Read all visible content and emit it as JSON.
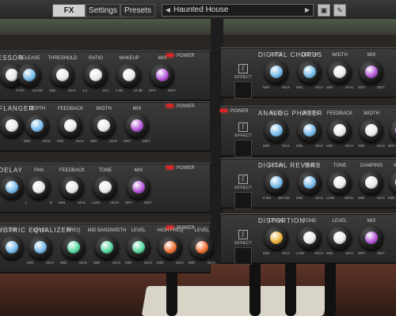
{
  "toolbar": {
    "tabs": [
      {
        "label": "FX",
        "active": true
      },
      {
        "label": "Settings",
        "active": false
      },
      {
        "label": "Presets",
        "active": false
      }
    ],
    "preset_name": "Haunted House",
    "prev_arrow": "◀",
    "next_arrow": "▶",
    "icons": [
      "save-icon",
      "edit-icon"
    ]
  },
  "colors": {
    "blue": "#6fb6e8",
    "white": "#e8e8e8",
    "purple": "#b24fd6",
    "green": "#4fd69a",
    "orange": "#ee6a2c",
    "yellow": "#e8b030",
    "led": "#e02222"
  },
  "power_label": "POWER",
  "effect_label": "EFFECT",
  "modules": [
    {
      "id": "compressor",
      "title": "RESSOR",
      "knobs": [
        {
          "label": "",
          "min": "",
          "max": "",
          "color": "white"
        },
        {
          "label": "RELEASE",
          "min": "FAST",
          "max": "SLOW",
          "color": "blue"
        },
        {
          "label": "THRESHOLD",
          "min": "MIN",
          "max": "MAX",
          "color": "white"
        },
        {
          "label": "RATIO",
          "min": "1:1",
          "max": "10:1",
          "color": "white"
        },
        {
          "label": "MAKEUP",
          "min": "0 dB",
          "max": "24 dB",
          "color": "white"
        },
        {
          "label": "MIX",
          "min": "DRY",
          "max": "WET",
          "color": "purple"
        }
      ]
    },
    {
      "id": "flanger",
      "title": "L FLANGER",
      "knobs": [
        {
          "label": "",
          "min": "",
          "max": "",
          "color": "white"
        },
        {
          "label": "DEPTH",
          "min": "MIN",
          "max": "MAX",
          "color": "blue"
        },
        {
          "label": "FEEDBACK",
          "min": "MIN",
          "max": "MAX",
          "color": "white"
        },
        {
          "label": "WIDTH",
          "min": "MIN",
          "max": "MAX",
          "color": "white"
        },
        {
          "label": "MIX",
          "min": "DRY",
          "max": "WET",
          "color": "purple"
        }
      ]
    },
    {
      "id": "delay",
      "title": "L DELAY",
      "knobs": [
        {
          "label": "",
          "min": "",
          "max": "",
          "color": "blue"
        },
        {
          "label": "PAN",
          "min": "L",
          "max": "R",
          "color": "white"
        },
        {
          "label": "FEEDBACK",
          "min": "MIN",
          "max": "MAX",
          "color": "white"
        },
        {
          "label": "TONE",
          "min": "LOW",
          "max": "HIGH",
          "color": "white"
        },
        {
          "label": "MIX",
          "min": "DRY",
          "max": "WET",
          "color": "purple"
        }
      ]
    },
    {
      "id": "equalizer",
      "title": "AMETRIC EQUALIZER",
      "knobs": [
        {
          "label": "LOW",
          "min": "",
          "max": "",
          "color": "blue"
        },
        {
          "label": "LEVEL",
          "min": "MIN",
          "max": "MAX",
          "color": "blue"
        },
        {
          "label": "FREQ",
          "min": "MIN",
          "max": "MAX",
          "color": "green"
        },
        {
          "label": "MID BANDWIDTH",
          "min": "MIN",
          "max": "MAX",
          "color": "green"
        },
        {
          "label": "LEVEL",
          "min": "MIN",
          "max": "MAX",
          "color": "green"
        },
        {
          "label": "HIGH FREQ",
          "min": "MIN",
          "max": "MAX",
          "color": "orange"
        },
        {
          "label": "LEVEL",
          "min": "MIN",
          "max": "MAX",
          "color": "orange"
        }
      ]
    },
    {
      "id": "chorus",
      "title": "DIGITAL CHORUS",
      "knobs": [
        {
          "label": "RATE",
          "min": "MIN",
          "max": "MAX",
          "color": "blue"
        },
        {
          "label": "DEPTH",
          "min": "MIN",
          "max": "MAX",
          "color": "blue"
        },
        {
          "label": "WIDTH",
          "min": "MIN",
          "max": "MAX",
          "color": "white"
        },
        {
          "label": "MIX",
          "min": "DRY",
          "max": "WET",
          "color": "purple"
        }
      ]
    },
    {
      "id": "phaser",
      "title": "ANALOG PHASER",
      "knobs": [
        {
          "label": "RATE",
          "min": "MIN",
          "max": "MAX",
          "color": "blue"
        },
        {
          "label": "DEPTH",
          "min": "MIN",
          "max": "MAX",
          "color": "blue"
        },
        {
          "label": "FEEDBACK",
          "min": "MIN",
          "max": "MAX",
          "color": "white"
        },
        {
          "label": "WIDTH",
          "min": "MIN",
          "max": "MAX",
          "color": "white"
        },
        {
          "label": "MIX",
          "min": "DRY",
          "max": "WET",
          "color": "purple"
        }
      ]
    },
    {
      "id": "reverb",
      "title": "DIGITAL REVERB",
      "knobs": [
        {
          "label": "DELAY",
          "min": "0 MS",
          "max": "400 MS",
          "color": "blue"
        },
        {
          "label": "TIME",
          "min": "MIN",
          "max": "MAX",
          "color": "blue"
        },
        {
          "label": "TONE",
          "min": "LOW",
          "max": "HIGH",
          "color": "white"
        },
        {
          "label": "DAMPING",
          "min": "MIN",
          "max": "MAX",
          "color": "white"
        },
        {
          "label": "WIDTH",
          "min": "MIN",
          "max": "MAX",
          "color": "white"
        }
      ]
    },
    {
      "id": "distortion",
      "title": "DISTORTION",
      "knobs": [
        {
          "label": "DRIVE",
          "min": "MIN",
          "max": "MAX",
          "color": "yellow"
        },
        {
          "label": "TONE",
          "min": "LOW",
          "max": "HIGH",
          "color": "white"
        },
        {
          "label": "LEVEL",
          "min": "MIN",
          "max": "MAX",
          "color": "white"
        },
        {
          "label": "MIX",
          "min": "DRY",
          "max": "WET",
          "color": "purple"
        }
      ]
    }
  ]
}
